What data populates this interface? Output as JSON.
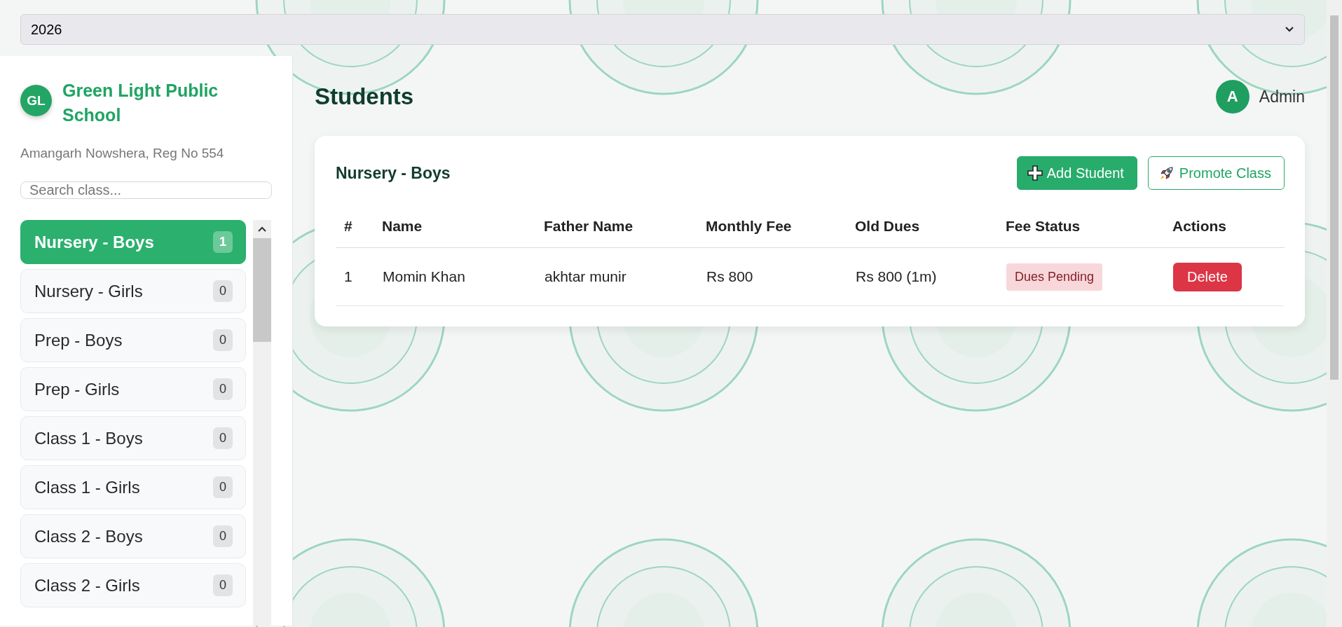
{
  "year_select": {
    "value": "2026"
  },
  "school": {
    "logo": "GL",
    "name": "Green Light Public School",
    "address": "Amangarh Nowshera, Reg No 554"
  },
  "class_search": {
    "placeholder": "Search class..."
  },
  "classes": [
    {
      "label": "Nursery - Boys",
      "count": "1",
      "selected": true
    },
    {
      "label": "Nursery - Girls",
      "count": "0",
      "selected": false
    },
    {
      "label": "Prep - Boys",
      "count": "0",
      "selected": false
    },
    {
      "label": "Prep - Girls",
      "count": "0",
      "selected": false
    },
    {
      "label": "Class 1 - Boys",
      "count": "0",
      "selected": false
    },
    {
      "label": "Class 1 - Girls",
      "count": "0",
      "selected": false
    },
    {
      "label": "Class 2 - Boys",
      "count": "0",
      "selected": false
    },
    {
      "label": "Class 2 - Girls",
      "count": "0",
      "selected": false
    }
  ],
  "page_title": "Students",
  "user": {
    "avatar": "A",
    "name": "Admin"
  },
  "card": {
    "title": "Nursery - Boys",
    "buttons": [
      {
        "kind": "primary",
        "label": "Add Student"
      },
      {
        "kind": "outline",
        "label": "Promote Class"
      }
    ]
  },
  "table": {
    "columns": [
      "#",
      "Name",
      "Father Name",
      "Monthly Fee",
      "Old Dues",
      "Fee Status",
      "Actions"
    ],
    "rows": [
      {
        "cells": [
          "1",
          "Momin Khan",
          "akhtar munir",
          "Rs 800",
          "Rs 800 (1m)"
        ],
        "status": {
          "kind": "pending",
          "label": "Dues Pending"
        },
        "action": "Delete"
      }
    ]
  }
}
